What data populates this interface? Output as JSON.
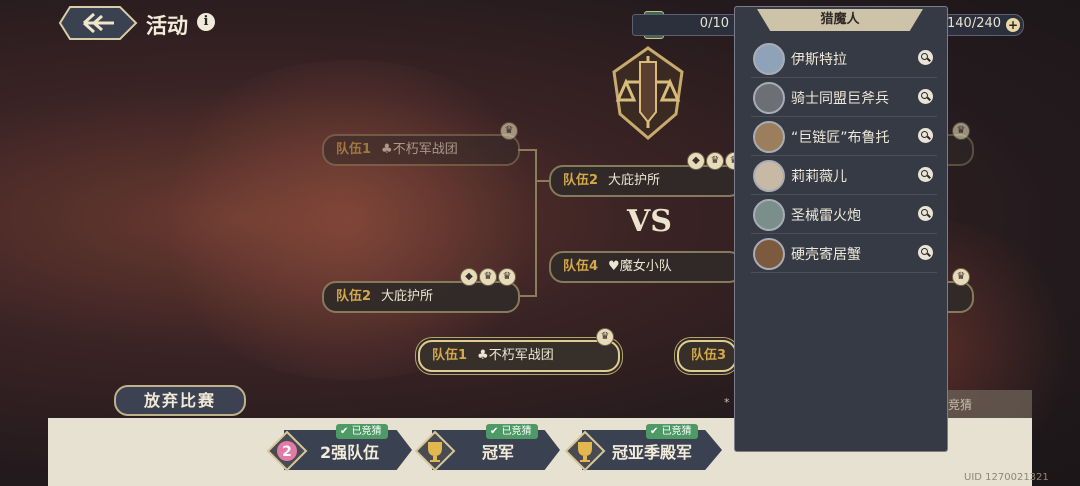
{
  "header": {
    "title": "活动",
    "info_label": "i"
  },
  "resources": {
    "counter": "0/10",
    "capacity": "140/240",
    "plus_label": "+"
  },
  "bracket": {
    "left_top": {
      "label": "队伍1",
      "name": "♣不朽军战团"
    },
    "left_bottom": {
      "label": "队伍2",
      "name": "大庇护所"
    },
    "mid_top": {
      "label": "队伍2",
      "name": "大庇护所"
    },
    "mid_bottom": {
      "label": "队伍4",
      "name": "♥魔女小队"
    },
    "vs": "VS",
    "final_left": {
      "label": "队伍1",
      "name": "♣不朽军战团"
    },
    "final_right": {
      "label": "队伍3",
      "name": ""
    }
  },
  "abandon_label": "放弃比赛",
  "tabs": [
    {
      "label": "2强队伍",
      "badge": "已竞猜",
      "icon": "2"
    },
    {
      "label": "冠军",
      "badge": "已竞猜",
      "icon": "trophy-icon"
    },
    {
      "label": "冠亚季殿军",
      "badge": "已竞猜",
      "icon": "trophy-icon"
    }
  ],
  "footer": {
    "note": "*",
    "guess": "竞猜",
    "uid": "UID 1270021321"
  },
  "popup": {
    "title": "猎魔人",
    "items": [
      {
        "name": "伊斯特拉"
      },
      {
        "name": "骑士同盟巨斧兵"
      },
      {
        "name": "“巨链匠”布鲁托"
      },
      {
        "name": "莉莉薇儿"
      },
      {
        "name": "圣械雷火炮"
      },
      {
        "name": "硬壳寄居蟹"
      }
    ]
  },
  "colors": {
    "gold": "#d4a94b",
    "badge_green": "#4e9a67",
    "panel": "#363a45"
  }
}
